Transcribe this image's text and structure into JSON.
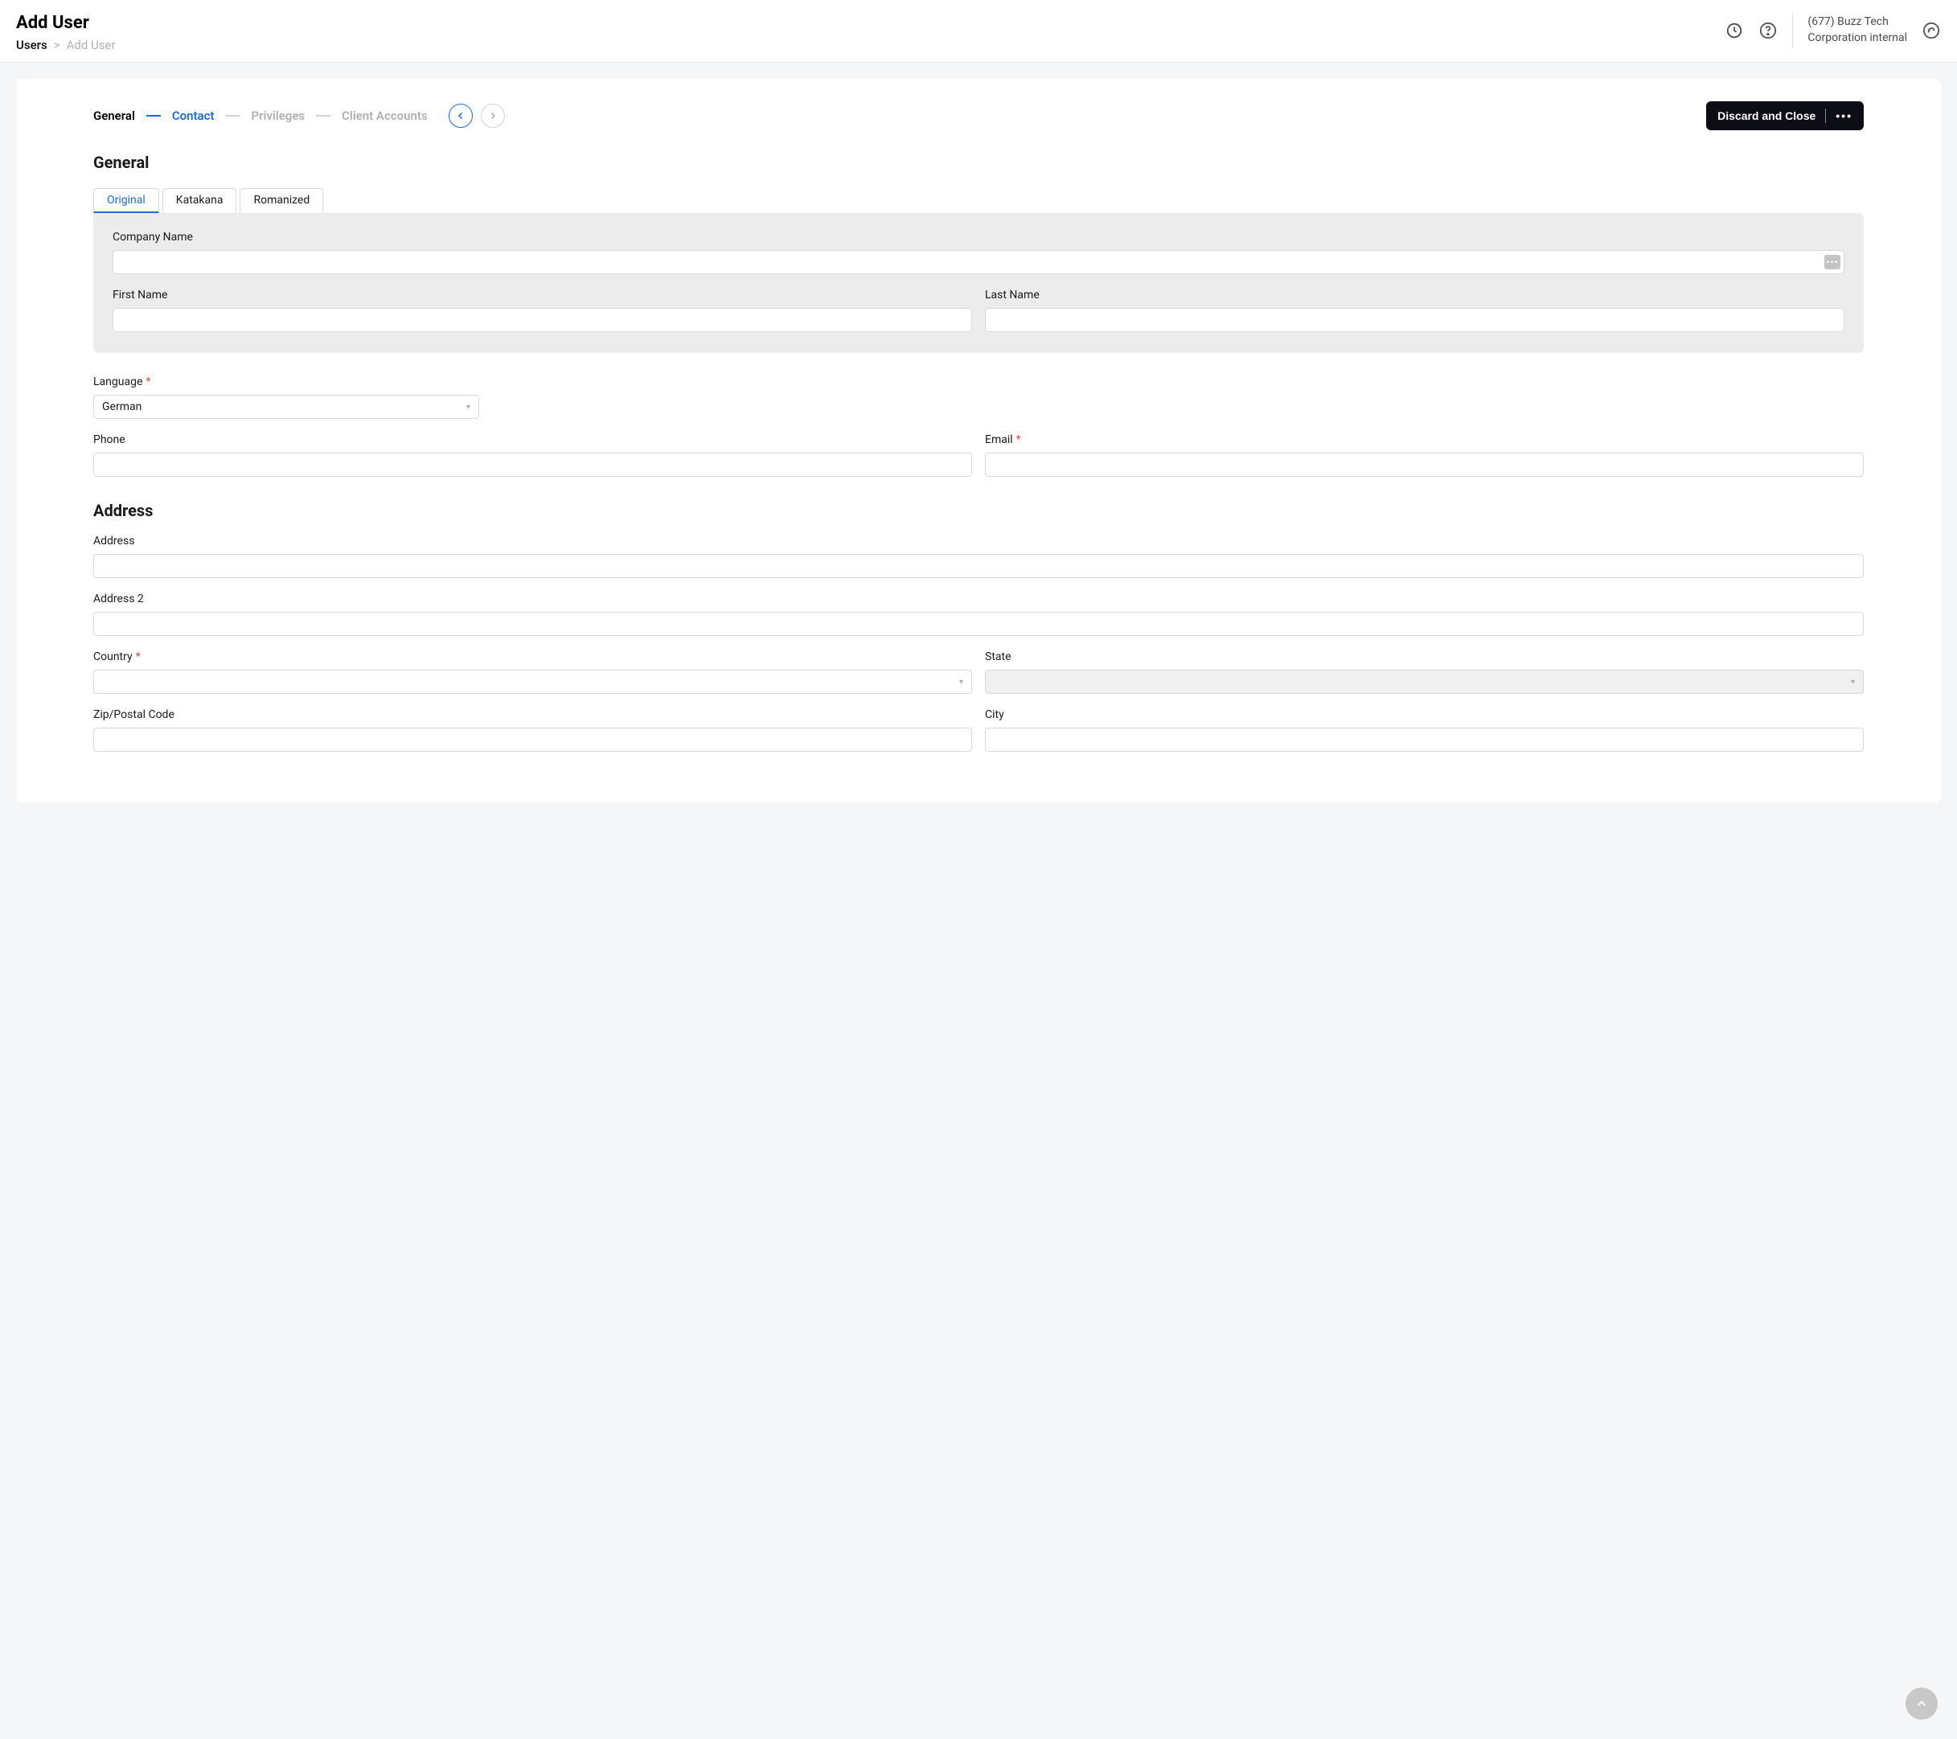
{
  "header": {
    "title": "Add User",
    "breadcrumb": {
      "root": "Users",
      "sep": ">",
      "current": "Add User"
    },
    "account_line1": "(677) Buzz Tech",
    "account_line2": "Corporation internal"
  },
  "wizard": {
    "steps": [
      "General",
      "Contact",
      "Privileges",
      "Client Accounts"
    ],
    "discard_label": "Discard and Close"
  },
  "sections": {
    "general_title": "General",
    "address_title": "Address"
  },
  "tabs": [
    "Original",
    "Katakana",
    "Romanized"
  ],
  "fields": {
    "company_name": {
      "label": "Company Name",
      "value": ""
    },
    "first_name": {
      "label": "First Name",
      "value": ""
    },
    "last_name": {
      "label": "Last Name",
      "value": ""
    },
    "language": {
      "label": "Language",
      "value": "German"
    },
    "phone": {
      "label": "Phone",
      "value": ""
    },
    "email": {
      "label": "Email",
      "value": ""
    },
    "address": {
      "label": "Address",
      "value": ""
    },
    "address2": {
      "label": "Address 2",
      "value": ""
    },
    "country": {
      "label": "Country",
      "value": ""
    },
    "state": {
      "label": "State",
      "value": ""
    },
    "zip": {
      "label": "Zip/Postal Code",
      "value": ""
    },
    "city": {
      "label": "City",
      "value": ""
    }
  }
}
